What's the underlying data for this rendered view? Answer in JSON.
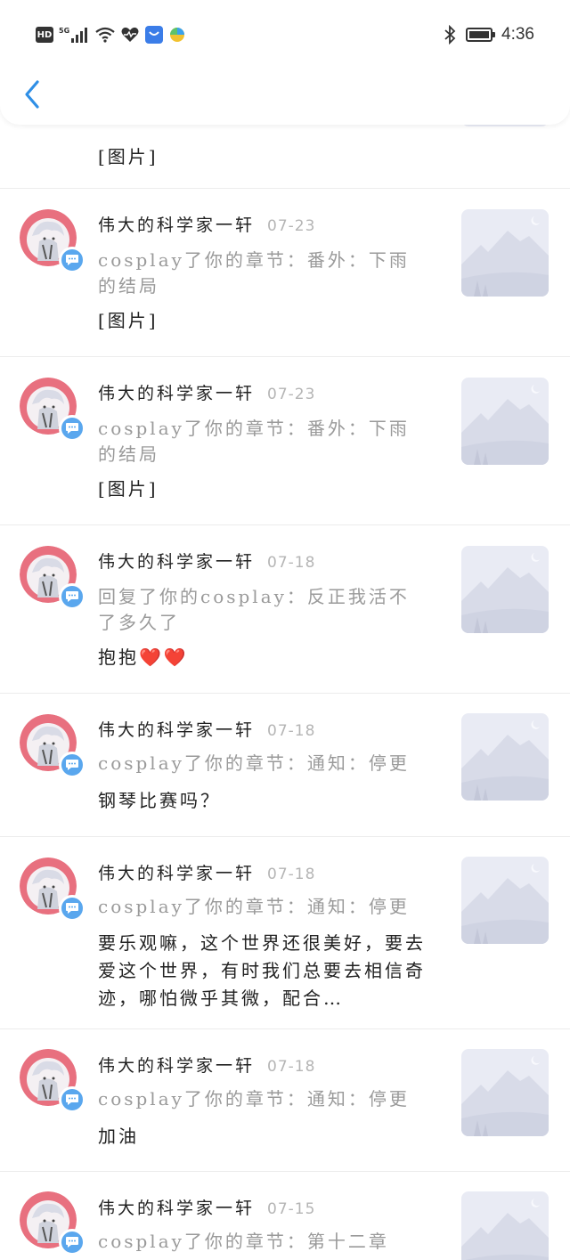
{
  "status_bar": {
    "hd": "HD",
    "network": "5G",
    "time": "4:36"
  },
  "nav": {
    "back_icon": "chevron-left-icon"
  },
  "top_partial": {
    "comment": "[图片]"
  },
  "notifications": [
    {
      "name": "伟大的科学家一轩",
      "date": "07-23",
      "action": "cosplay了你的章节：番外：下雨的结局",
      "comment": "[图片]"
    },
    {
      "name": "伟大的科学家一轩",
      "date": "07-23",
      "action": "cosplay了你的章节：番外：下雨的结局",
      "comment": "[图片]"
    },
    {
      "name": "伟大的科学家一轩",
      "date": "07-18",
      "action": "回复了你的cosplay：反正我活不了多久了",
      "comment": "抱抱❤️❤️"
    },
    {
      "name": "伟大的科学家一轩",
      "date": "07-18",
      "action": "cosplay了你的章节：通知：停更",
      "comment": "钢琴比赛吗？"
    },
    {
      "name": "伟大的科学家一轩",
      "date": "07-18",
      "action": "cosplay了你的章节：通知：停更",
      "comment": "要乐观嘛，这个世界还很美好，要去爱这个世界，有时我们总要去相信奇迹，哪怕微乎其微，配合…"
    },
    {
      "name": "伟大的科学家一轩",
      "date": "07-18",
      "action": "cosplay了你的章节：通知：停更",
      "comment": "加油"
    },
    {
      "name": "伟大的科学家一轩",
      "date": "07-15",
      "action": "cosplay了你的章节：第十二章",
      "comment": ""
    }
  ],
  "colors": {
    "accent": "#2f8fe6",
    "badge": "#5aa7ee",
    "avatar_ring": "#e8707f",
    "thumb_bg": "#e9ebf4"
  }
}
